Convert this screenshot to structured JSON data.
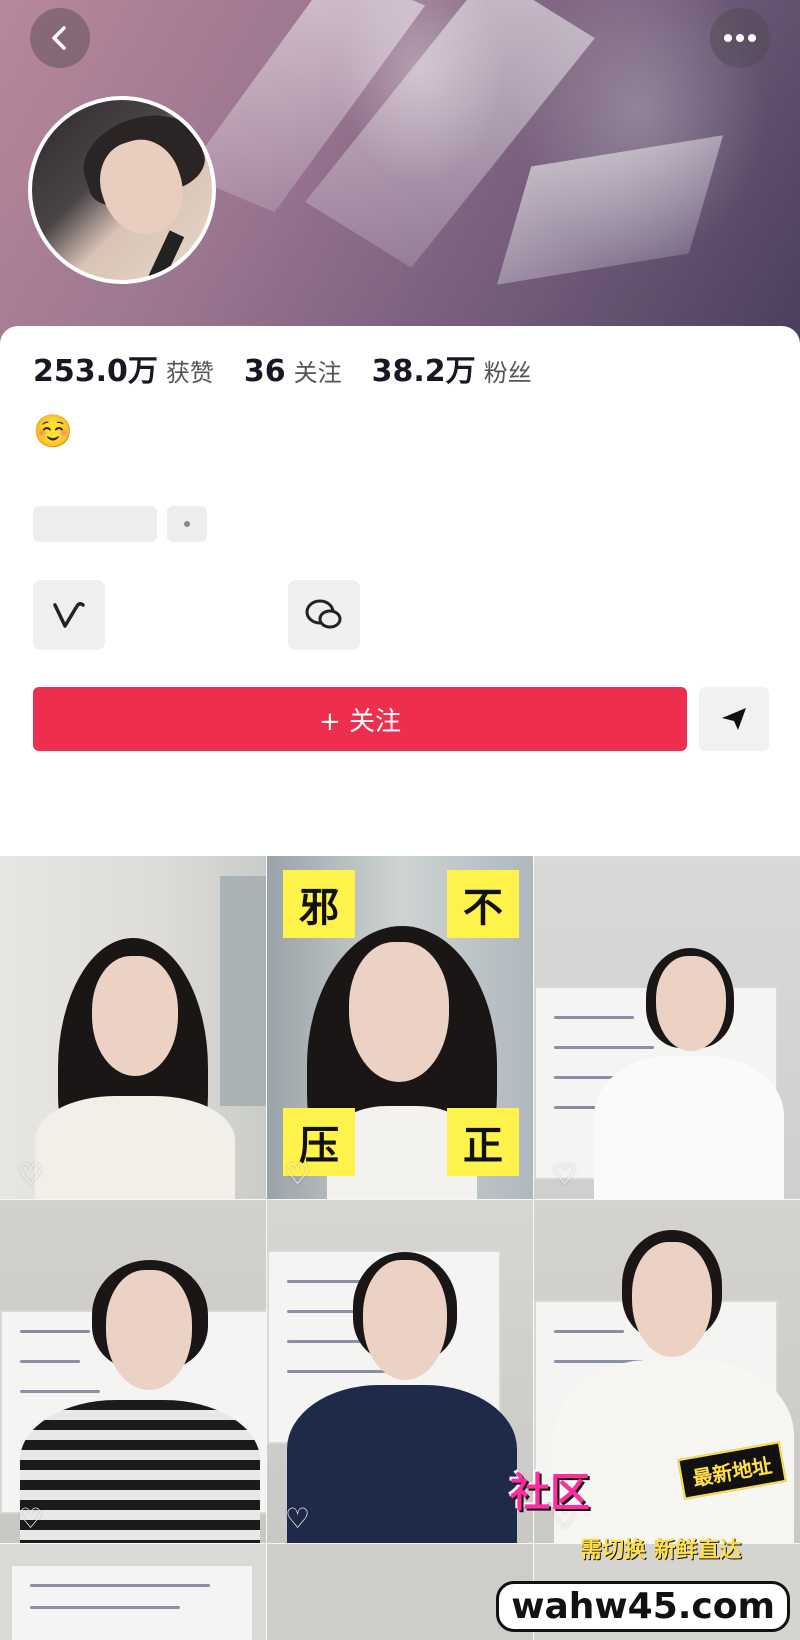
{
  "header": {
    "back_icon": "chevron-left-icon",
    "more_icon": "more-dots-icon"
  },
  "stats": [
    {
      "value": "253.0万",
      "label": "获赞"
    },
    {
      "value": "36",
      "label": "关注"
    },
    {
      "value": "38.2万",
      "label": "粉丝"
    }
  ],
  "bio": {
    "emoji": "☺️"
  },
  "actions": {
    "follow_label": "+ 关注",
    "follow_color": "#ee2e4f",
    "share_icon": "send-icon",
    "icon_left": "v-logo-icon",
    "icon_right": "chat-bubbles-icon"
  },
  "video_tags": {
    "tl": "邪",
    "tr": "不",
    "bl": "压",
    "br": "正"
  },
  "watermark": {
    "title": "社区",
    "badge": "最新地址",
    "sub": "需切换 新鲜直达",
    "url": "wahw45.com"
  }
}
